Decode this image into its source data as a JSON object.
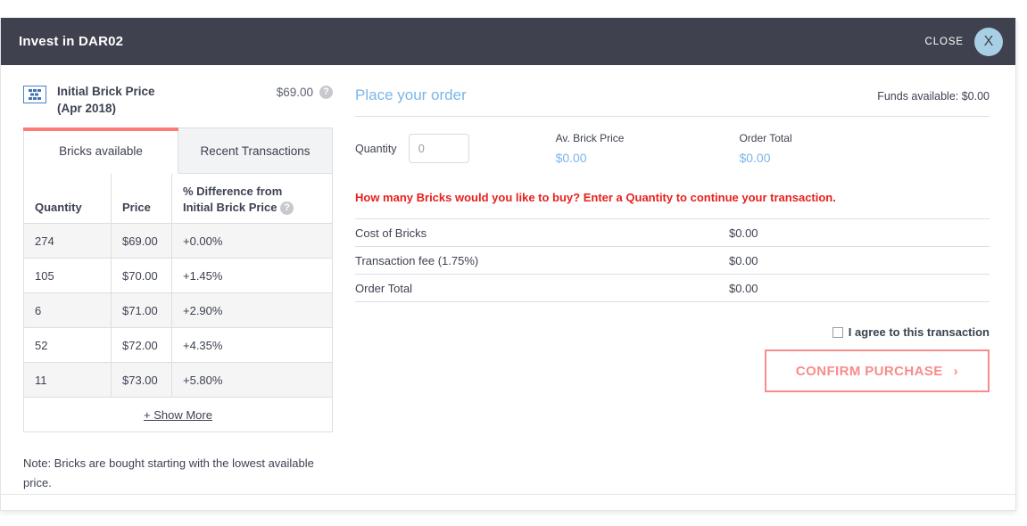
{
  "header": {
    "title": "Invest in DAR02",
    "close_label": "CLOSE",
    "close_icon_glyph": "X",
    "bg_color": "#3f414e",
    "close_circle_color": "#a9cfe4"
  },
  "left": {
    "initial_brick_price": {
      "icon": "brick-icon",
      "label": "Initial Brick Price",
      "sub_label": "(Apr 2018)",
      "value": "$69.00",
      "help_icon_glyph": "?"
    },
    "tabs": [
      {
        "label": "Bricks available",
        "active": true
      },
      {
        "label": "Recent Transactions",
        "active": false
      }
    ],
    "table": {
      "columns": [
        "Quantity",
        "Price",
        "% Difference from Initial Brick Price"
      ],
      "column_help_icon_glyph": "?",
      "col_diff_line1": "% Difference from",
      "col_diff_line2": "Initial Brick Price",
      "rows": [
        {
          "quantity": "274",
          "price": "$69.00",
          "difference": "+0.00%"
        },
        {
          "quantity": "105",
          "price": "$70.00",
          "difference": "+1.45%"
        },
        {
          "quantity": "6",
          "price": "$71.00",
          "difference": "+2.90%"
        },
        {
          "quantity": "52",
          "price": "$72.00",
          "difference": "+4.35%"
        },
        {
          "quantity": "11",
          "price": "$73.00",
          "difference": "+5.80%"
        }
      ],
      "show_more_label": "+ Show More"
    },
    "note": "Note: Bricks are bought starting with the lowest available price.",
    "accent_color": "#fb7a7a"
  },
  "right": {
    "order_title": "Place your order",
    "funds_available": "Funds available: $0.00",
    "quantity": {
      "label": "Quantity",
      "value": "",
      "placeholder": "0"
    },
    "metrics": [
      {
        "label": "Av. Brick Price",
        "value": "$0.00"
      },
      {
        "label": "Order Total",
        "value": "$0.00"
      }
    ],
    "error_message": "How many Bricks would you like to buy? Enter a Quantity to continue your transaction.",
    "error_color": "#e8201d",
    "summary": [
      {
        "label": "Cost of Bricks",
        "value": "$0.00"
      },
      {
        "label": "Transaction fee (1.75%)",
        "value": "$0.00"
      },
      {
        "label": "Order Total",
        "value": "$0.00"
      }
    ],
    "agreement": {
      "checked": false,
      "label": "I agree to this transaction"
    },
    "confirm_button": {
      "label": "CONFIRM PURCHASE",
      "chevron": "›",
      "color": "#f98b8b"
    },
    "accent_color": "#7cb5e8"
  }
}
